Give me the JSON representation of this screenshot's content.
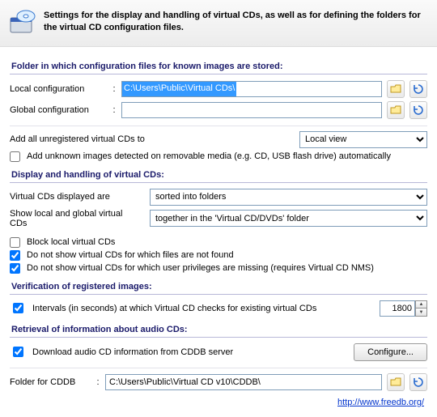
{
  "header": {
    "text": "Settings for the display and handling of virtual CDs, as well as for defining the folders for the virtual CD configuration files."
  },
  "section1": {
    "title": "Folder in which configuration files for known images are stored:",
    "local_label": "Local configuration",
    "local_value": "C:\\Users\\Public\\Virtual CDs\\",
    "global_label": "Global configuration",
    "global_value": ""
  },
  "addUnreg": {
    "label": "Add all unregistered virtual CDs to",
    "combo_value": "Local view",
    "combo_options": [
      "Local view"
    ]
  },
  "addUnknown": {
    "label": "Add unknown images detected on removable media (e.g. CD, USB flash drive) automatically"
  },
  "section2": {
    "title": "Display and handling of virtual CDs:",
    "displayed_label": "Virtual CDs displayed are",
    "displayed_value": "sorted into folders",
    "displayed_options": [
      "sorted into folders"
    ],
    "showlg_label": "Show local and global virtual CDs",
    "showlg_value": "together in the 'Virtual CD/DVDs' folder",
    "showlg_options": [
      "together in the 'Virtual CD/DVDs' folder"
    ],
    "block_label": "Block local virtual CDs",
    "notfound_label": "Do not show virtual CDs for which files are not found",
    "priv_label": "Do not show virtual CDs for which user privileges are missing (requires Virtual CD NMS)"
  },
  "section3": {
    "title": "Verification of registered images:",
    "interval_label": "Intervals (in seconds) at which Virtual CD checks for existing virtual CDs",
    "interval_value": "1800"
  },
  "section4": {
    "title": "Retrieval of information about audio CDs:",
    "dl_label": "Download audio CD information from CDDB server",
    "configure_btn": "Configure..."
  },
  "cddb": {
    "label": "Folder for CDDB",
    "value": "C:\\Users\\Public\\Virtual CD v10\\CDDB\\"
  },
  "link": {
    "text": "http://www.freedb.org/",
    "href": "http://www.freedb.org/"
  }
}
